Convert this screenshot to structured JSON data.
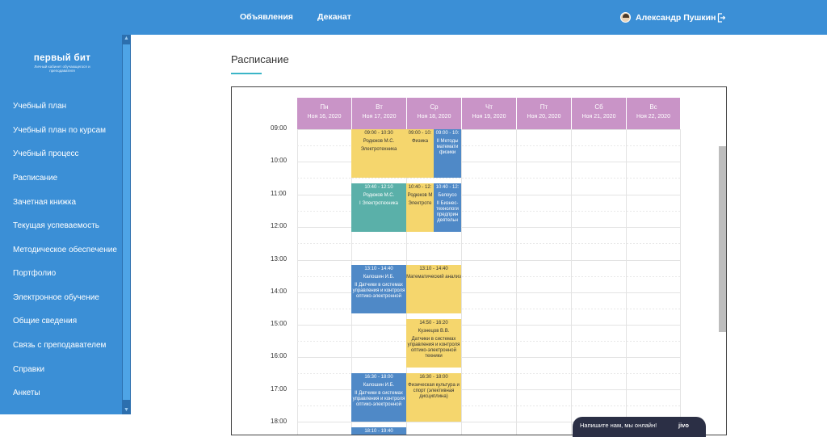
{
  "topnav": {
    "announcements": "Объявления",
    "dean": "Деканат",
    "user": "Александр Пушкин"
  },
  "logo": {
    "title": "первый бит",
    "subtitle": "Личный кабинет обучающегося и преподавателя"
  },
  "sidebar": {
    "items": [
      {
        "label": "Учебный план"
      },
      {
        "label": "Учебный план по курсам"
      },
      {
        "label": "Учебный процесс"
      },
      {
        "label": "Расписание"
      },
      {
        "label": "Зачетная книжка"
      },
      {
        "label": "Текущая успеваемость"
      },
      {
        "label": "Методическое обеспечение"
      },
      {
        "label": "Портфолио"
      },
      {
        "label": "Электронное обучение"
      },
      {
        "label": "Общие сведения"
      },
      {
        "label": "Связь с преподавателем"
      },
      {
        "label": "Справки"
      },
      {
        "label": "Анкеты"
      }
    ]
  },
  "page": {
    "title": "Расписание"
  },
  "calendar": {
    "days": [
      {
        "day": "Пн",
        "date": "Ноя 16, 2020"
      },
      {
        "day": "Вт",
        "date": "Ноя 17, 2020"
      },
      {
        "day": "Ср",
        "date": "Ноя 18, 2020"
      },
      {
        "day": "Чт",
        "date": "Ноя 19, 2020"
      },
      {
        "day": "Пт",
        "date": "Ноя 20, 2020"
      },
      {
        "day": "Сб",
        "date": "Ноя 21, 2020"
      },
      {
        "day": "Вс",
        "date": "Ноя 22, 2020"
      }
    ],
    "times": [
      "09:00",
      "10:00",
      "11:00",
      "12:00",
      "13:00",
      "14:00",
      "15:00",
      "16:00",
      "17:00",
      "18:00"
    ],
    "events": [
      {
        "time": "09:00 - 10:30",
        "teacher": "Родюков М.С.",
        "subject": "Электротехника"
      },
      {
        "time": "09:00 - 10:",
        "teacher": "",
        "subject": "Физика"
      },
      {
        "time": "09:00 - 10:",
        "teacher": "",
        "subject": "II Методы математи физики"
      },
      {
        "time": "10:40 - 12:10",
        "teacher": "Родюков М.С.",
        "subject": "I Электротехника"
      },
      {
        "time": "10:40 - 12:",
        "teacher": "Родюков М",
        "subject": "Электроте"
      },
      {
        "time": "10:40 - 12:",
        "teacher": "Белоусо",
        "subject": "II Бизнес-технологи предприн деятельн"
      },
      {
        "time": "13:10 - 14:40",
        "teacher": "Калошин И.Б.",
        "subject": "II Датчики в системах управления и контроля оптико-электронной"
      },
      {
        "time": "13:10 - 14:40",
        "teacher": "",
        "subject": "Математический анализ"
      },
      {
        "time": "14:50 - 16:20",
        "teacher": "Кузнецов В.В.",
        "subject": "Датчики в системах управления и контроля оптико-электронной техники"
      },
      {
        "time": "16:30 - 18:00",
        "teacher": "Калошин И.Б.",
        "subject": "II Датчики в системах управления и контроля оптико-электронной"
      },
      {
        "time": "16:30 - 18:00",
        "teacher": "",
        "subject": "Физическая культура и спорт (элективная дисциплина)"
      },
      {
        "time": "18:10 - 19:40",
        "teacher": "",
        "subject": ""
      }
    ]
  },
  "chat": {
    "text": "Напишите нам, мы онлайн!",
    "brand": "jivo"
  },
  "colors": {
    "topbar": "#3b8fd6",
    "header_cell": "#c994c7",
    "yellow": "#f5d66d",
    "blue": "#4f89c7",
    "teal": "#5ab0a9"
  }
}
